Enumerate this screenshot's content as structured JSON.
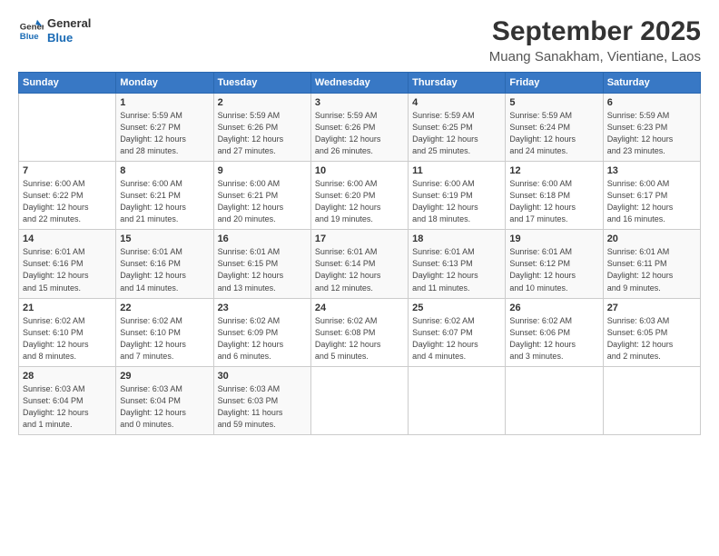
{
  "header": {
    "logo_line1": "General",
    "logo_line2": "Blue",
    "title": "September 2025",
    "subtitle": "Muang Sanakham, Vientiane, Laos"
  },
  "days_of_week": [
    "Sunday",
    "Monday",
    "Tuesday",
    "Wednesday",
    "Thursday",
    "Friday",
    "Saturday"
  ],
  "weeks": [
    [
      {
        "num": "",
        "detail": ""
      },
      {
        "num": "1",
        "detail": "Sunrise: 5:59 AM\nSunset: 6:27 PM\nDaylight: 12 hours\nand 28 minutes."
      },
      {
        "num": "2",
        "detail": "Sunrise: 5:59 AM\nSunset: 6:26 PM\nDaylight: 12 hours\nand 27 minutes."
      },
      {
        "num": "3",
        "detail": "Sunrise: 5:59 AM\nSunset: 6:26 PM\nDaylight: 12 hours\nand 26 minutes."
      },
      {
        "num": "4",
        "detail": "Sunrise: 5:59 AM\nSunset: 6:25 PM\nDaylight: 12 hours\nand 25 minutes."
      },
      {
        "num": "5",
        "detail": "Sunrise: 5:59 AM\nSunset: 6:24 PM\nDaylight: 12 hours\nand 24 minutes."
      },
      {
        "num": "6",
        "detail": "Sunrise: 5:59 AM\nSunset: 6:23 PM\nDaylight: 12 hours\nand 23 minutes."
      }
    ],
    [
      {
        "num": "7",
        "detail": "Sunrise: 6:00 AM\nSunset: 6:22 PM\nDaylight: 12 hours\nand 22 minutes."
      },
      {
        "num": "8",
        "detail": "Sunrise: 6:00 AM\nSunset: 6:21 PM\nDaylight: 12 hours\nand 21 minutes."
      },
      {
        "num": "9",
        "detail": "Sunrise: 6:00 AM\nSunset: 6:21 PM\nDaylight: 12 hours\nand 20 minutes."
      },
      {
        "num": "10",
        "detail": "Sunrise: 6:00 AM\nSunset: 6:20 PM\nDaylight: 12 hours\nand 19 minutes."
      },
      {
        "num": "11",
        "detail": "Sunrise: 6:00 AM\nSunset: 6:19 PM\nDaylight: 12 hours\nand 18 minutes."
      },
      {
        "num": "12",
        "detail": "Sunrise: 6:00 AM\nSunset: 6:18 PM\nDaylight: 12 hours\nand 17 minutes."
      },
      {
        "num": "13",
        "detail": "Sunrise: 6:00 AM\nSunset: 6:17 PM\nDaylight: 12 hours\nand 16 minutes."
      }
    ],
    [
      {
        "num": "14",
        "detail": "Sunrise: 6:01 AM\nSunset: 6:16 PM\nDaylight: 12 hours\nand 15 minutes."
      },
      {
        "num": "15",
        "detail": "Sunrise: 6:01 AM\nSunset: 6:16 PM\nDaylight: 12 hours\nand 14 minutes."
      },
      {
        "num": "16",
        "detail": "Sunrise: 6:01 AM\nSunset: 6:15 PM\nDaylight: 12 hours\nand 13 minutes."
      },
      {
        "num": "17",
        "detail": "Sunrise: 6:01 AM\nSunset: 6:14 PM\nDaylight: 12 hours\nand 12 minutes."
      },
      {
        "num": "18",
        "detail": "Sunrise: 6:01 AM\nSunset: 6:13 PM\nDaylight: 12 hours\nand 11 minutes."
      },
      {
        "num": "19",
        "detail": "Sunrise: 6:01 AM\nSunset: 6:12 PM\nDaylight: 12 hours\nand 10 minutes."
      },
      {
        "num": "20",
        "detail": "Sunrise: 6:01 AM\nSunset: 6:11 PM\nDaylight: 12 hours\nand 9 minutes."
      }
    ],
    [
      {
        "num": "21",
        "detail": "Sunrise: 6:02 AM\nSunset: 6:10 PM\nDaylight: 12 hours\nand 8 minutes."
      },
      {
        "num": "22",
        "detail": "Sunrise: 6:02 AM\nSunset: 6:10 PM\nDaylight: 12 hours\nand 7 minutes."
      },
      {
        "num": "23",
        "detail": "Sunrise: 6:02 AM\nSunset: 6:09 PM\nDaylight: 12 hours\nand 6 minutes."
      },
      {
        "num": "24",
        "detail": "Sunrise: 6:02 AM\nSunset: 6:08 PM\nDaylight: 12 hours\nand 5 minutes."
      },
      {
        "num": "25",
        "detail": "Sunrise: 6:02 AM\nSunset: 6:07 PM\nDaylight: 12 hours\nand 4 minutes."
      },
      {
        "num": "26",
        "detail": "Sunrise: 6:02 AM\nSunset: 6:06 PM\nDaylight: 12 hours\nand 3 minutes."
      },
      {
        "num": "27",
        "detail": "Sunrise: 6:03 AM\nSunset: 6:05 PM\nDaylight: 12 hours\nand 2 minutes."
      }
    ],
    [
      {
        "num": "28",
        "detail": "Sunrise: 6:03 AM\nSunset: 6:04 PM\nDaylight: 12 hours\nand 1 minute."
      },
      {
        "num": "29",
        "detail": "Sunrise: 6:03 AM\nSunset: 6:04 PM\nDaylight: 12 hours\nand 0 minutes."
      },
      {
        "num": "30",
        "detail": "Sunrise: 6:03 AM\nSunset: 6:03 PM\nDaylight: 11 hours\nand 59 minutes."
      },
      {
        "num": "",
        "detail": ""
      },
      {
        "num": "",
        "detail": ""
      },
      {
        "num": "",
        "detail": ""
      },
      {
        "num": "",
        "detail": ""
      }
    ]
  ]
}
